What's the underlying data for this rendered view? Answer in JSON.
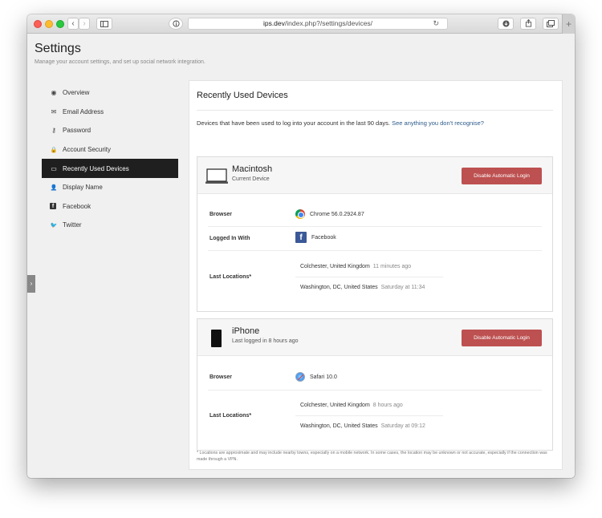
{
  "browser": {
    "url_domain": "ips.dev",
    "url_path": "/index.php?/settings/devices/",
    "back_glyph": "‹",
    "forward_glyph": "›",
    "reload_glyph": "↻",
    "new_tab_glyph": "+"
  },
  "header": {
    "title": "Settings",
    "subtitle": "Manage your account settings, and set up social network integration."
  },
  "sidebar": {
    "items": [
      {
        "label": "Overview",
        "icon": "dashboard-icon",
        "glyph": "◉"
      },
      {
        "label": "Email Address",
        "icon": "envelope-icon",
        "glyph": "✉"
      },
      {
        "label": "Password",
        "icon": "key-icon",
        "glyph": "⚷"
      },
      {
        "label": "Account Security",
        "icon": "lock-icon",
        "glyph": "🔒"
      },
      {
        "label": "Recently Used Devices",
        "icon": "laptop-icon",
        "glyph": "▭"
      },
      {
        "label": "Display Name",
        "icon": "user-icon",
        "glyph": "👤"
      },
      {
        "label": "Facebook",
        "icon": "facebook-icon",
        "glyph": "f"
      },
      {
        "label": "Twitter",
        "icon": "twitter-icon",
        "glyph": "🐦"
      }
    ],
    "active_index": 4,
    "panel_toggle_glyph": "›"
  },
  "main": {
    "title": "Recently Used Devices",
    "intro": "Devices that have been used to log into your account in the last 90 days.",
    "intro_link": "See anything you don't recognise?",
    "labels": {
      "browser": "Browser",
      "logged_in_with": "Logged In With",
      "last_locations": "Last Locations*"
    },
    "devices": [
      {
        "name": "Macintosh",
        "subtitle": "Current Device",
        "button": "Disable Automatic Login",
        "browser": "Chrome 56.0.2924.87",
        "logged_in_with": "Facebook",
        "locations": [
          {
            "place": "Colchester, United Kingdom",
            "time": "11 minutes ago"
          },
          {
            "place": "Washington, DC, United States",
            "time": "Saturday at 11:34"
          }
        ]
      },
      {
        "name": "iPhone",
        "subtitle": "Last logged in 8 hours ago",
        "button": "Disable Automatic Login",
        "browser": "Safari 10.0",
        "locations": [
          {
            "place": "Colchester, United Kingdom",
            "time": "8 hours ago"
          },
          {
            "place": "Washington, DC, United States",
            "time": "Saturday at 09:12"
          }
        ]
      }
    ],
    "footnote": "* Locations are approximate and may include nearby towns, especially on a mobile network. In some cases, the location may be unknown or not accurate, especially if the connection was made through a VPN."
  },
  "colors": {
    "accent_button": "#bd5050",
    "active_nav": "#1f1f1f",
    "link": "#2c5b8a"
  }
}
